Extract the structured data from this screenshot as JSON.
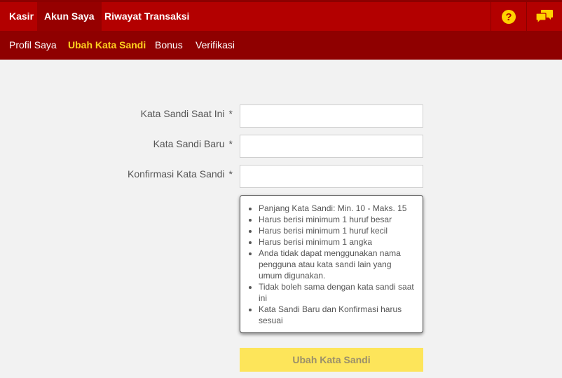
{
  "colors": {
    "topbar": "#b30000",
    "topbar_active": "#960000",
    "subbar": "#8f0000",
    "subbar_active_text": "#ffd21f",
    "icon_yellow": "#ffd200",
    "button_bg": "#fde55a"
  },
  "topnav": {
    "tabs": [
      {
        "label": "Kasir"
      },
      {
        "label": "Akun Saya",
        "active": true
      },
      {
        "label": "Riwayat Transaksi"
      }
    ],
    "icons": [
      "help-icon",
      "chat-icon"
    ]
  },
  "subnav": {
    "tabs": [
      {
        "label": "Profil Saya"
      },
      {
        "label": "Ubah Kata Sandi",
        "active": true
      },
      {
        "label": "Bonus"
      },
      {
        "label": "Verifikasi"
      }
    ]
  },
  "form": {
    "current_password": {
      "label": "Kata Sandi Saat Ini",
      "required_mark": "*",
      "value": ""
    },
    "new_password": {
      "label": "Kata Sandi Baru",
      "required_mark": "*",
      "value": ""
    },
    "confirm_password": {
      "label": "Konfirmasi Kata Sandi",
      "required_mark": "*",
      "value": ""
    },
    "rules": [
      "Panjang Kata Sandi: Min. 10 - Maks. 15",
      "Harus berisi minimum 1 huruf besar",
      "Harus berisi minimum 1 huruf kecil",
      "Harus berisi minimum 1 angka",
      "Anda tidak dapat menggunakan nama pengguna atau kata sandi lain yang umum digunakan.",
      "Tidak boleh sama dengan kata sandi saat ini",
      "Kata Sandi Baru dan Konfirmasi harus sesuai"
    ],
    "submit_label": "Ubah Kata Sandi"
  }
}
